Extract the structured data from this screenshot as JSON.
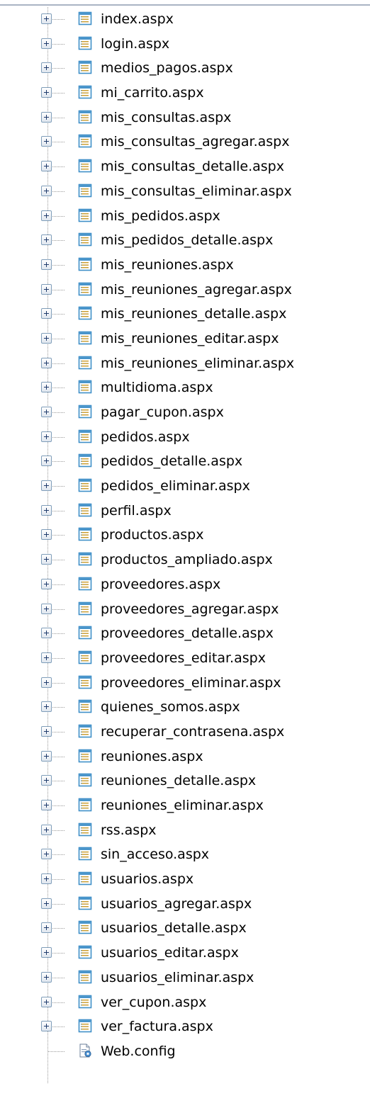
{
  "solution_explorer": {
    "aspx_files": [
      {
        "name": "index.aspx",
        "icon": "aspx-page-icon"
      },
      {
        "name": "login.aspx",
        "icon": "aspx-page-icon"
      },
      {
        "name": "medios_pagos.aspx",
        "icon": "aspx-page-icon"
      },
      {
        "name": "mi_carrito.aspx",
        "icon": "aspx-page-icon"
      },
      {
        "name": "mis_consultas.aspx",
        "icon": "aspx-page-icon"
      },
      {
        "name": "mis_consultas_agregar.aspx",
        "icon": "aspx-page-icon"
      },
      {
        "name": "mis_consultas_detalle.aspx",
        "icon": "aspx-page-icon"
      },
      {
        "name": "mis_consultas_eliminar.aspx",
        "icon": "aspx-page-icon"
      },
      {
        "name": "mis_pedidos.aspx",
        "icon": "aspx-page-icon"
      },
      {
        "name": "mis_pedidos_detalle.aspx",
        "icon": "aspx-page-icon"
      },
      {
        "name": "mis_reuniones.aspx",
        "icon": "aspx-page-icon"
      },
      {
        "name": "mis_reuniones_agregar.aspx",
        "icon": "aspx-page-icon"
      },
      {
        "name": "mis_reuniones_detalle.aspx",
        "icon": "aspx-page-icon"
      },
      {
        "name": "mis_reuniones_editar.aspx",
        "icon": "aspx-page-icon"
      },
      {
        "name": "mis_reuniones_eliminar.aspx",
        "icon": "aspx-page-icon"
      },
      {
        "name": "multidioma.aspx",
        "icon": "aspx-page-icon"
      },
      {
        "name": "pagar_cupon.aspx",
        "icon": "aspx-page-icon"
      },
      {
        "name": "pedidos.aspx",
        "icon": "aspx-page-icon"
      },
      {
        "name": "pedidos_detalle.aspx",
        "icon": "aspx-page-icon"
      },
      {
        "name": "pedidos_eliminar.aspx",
        "icon": "aspx-page-icon"
      },
      {
        "name": "perfil.aspx",
        "icon": "aspx-page-icon"
      },
      {
        "name": "productos.aspx",
        "icon": "aspx-page-icon"
      },
      {
        "name": "productos_ampliado.aspx",
        "icon": "aspx-page-icon"
      },
      {
        "name": "proveedores.aspx",
        "icon": "aspx-page-icon"
      },
      {
        "name": "proveedores_agregar.aspx",
        "icon": "aspx-page-icon"
      },
      {
        "name": "proveedores_detalle.aspx",
        "icon": "aspx-page-icon"
      },
      {
        "name": "proveedores_editar.aspx",
        "icon": "aspx-page-icon"
      },
      {
        "name": "proveedores_eliminar.aspx",
        "icon": "aspx-page-icon"
      },
      {
        "name": "quienes_somos.aspx",
        "icon": "aspx-page-icon"
      },
      {
        "name": "recuperar_contrasena.aspx",
        "icon": "aspx-page-icon"
      },
      {
        "name": "reuniones.aspx",
        "icon": "aspx-page-icon"
      },
      {
        "name": "reuniones_detalle.aspx",
        "icon": "aspx-page-icon"
      },
      {
        "name": "reuniones_eliminar.aspx",
        "icon": "aspx-page-icon"
      },
      {
        "name": "rss.aspx",
        "icon": "aspx-page-icon"
      },
      {
        "name": "sin_acceso.aspx",
        "icon": "aspx-page-icon"
      },
      {
        "name": "usuarios.aspx",
        "icon": "aspx-page-icon"
      },
      {
        "name": "usuarios_agregar.aspx",
        "icon": "aspx-page-icon"
      },
      {
        "name": "usuarios_detalle.aspx",
        "icon": "aspx-page-icon"
      },
      {
        "name": "usuarios_editar.aspx",
        "icon": "aspx-page-icon"
      },
      {
        "name": "usuarios_eliminar.aspx",
        "icon": "aspx-page-icon"
      },
      {
        "name": "ver_cupon.aspx",
        "icon": "aspx-page-icon"
      },
      {
        "name": "ver_factura.aspx",
        "icon": "aspx-page-icon"
      }
    ],
    "config_file": {
      "name": "Web.config",
      "icon": "config-file-icon"
    }
  },
  "colors": {
    "icon_frame": "#3f8fc8",
    "icon_fill": "#ffffff",
    "icon_lines": "#c89a2c",
    "tree_lines": "#9a9a9a"
  }
}
